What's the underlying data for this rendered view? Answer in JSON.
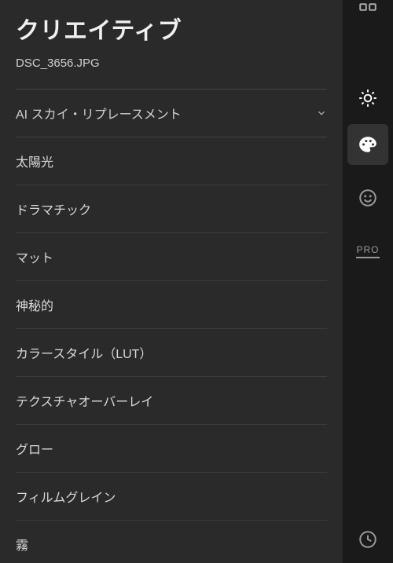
{
  "panel": {
    "title": "クリエイティブ",
    "filename": "DSC_3656.JPG",
    "ai_row": {
      "label": "AI スカイ・リプレースメント"
    },
    "items": [
      {
        "label": "太陽光"
      },
      {
        "label": "ドラマチック"
      },
      {
        "label": "マット"
      },
      {
        "label": "神秘的"
      },
      {
        "label": "カラースタイル（LUT）"
      },
      {
        "label": "テクスチャオーバーレイ"
      },
      {
        "label": "グロー"
      },
      {
        "label": "フィルムグレイン"
      },
      {
        "label": "霧"
      }
    ]
  },
  "sidebar": {
    "pro": "PRO"
  }
}
